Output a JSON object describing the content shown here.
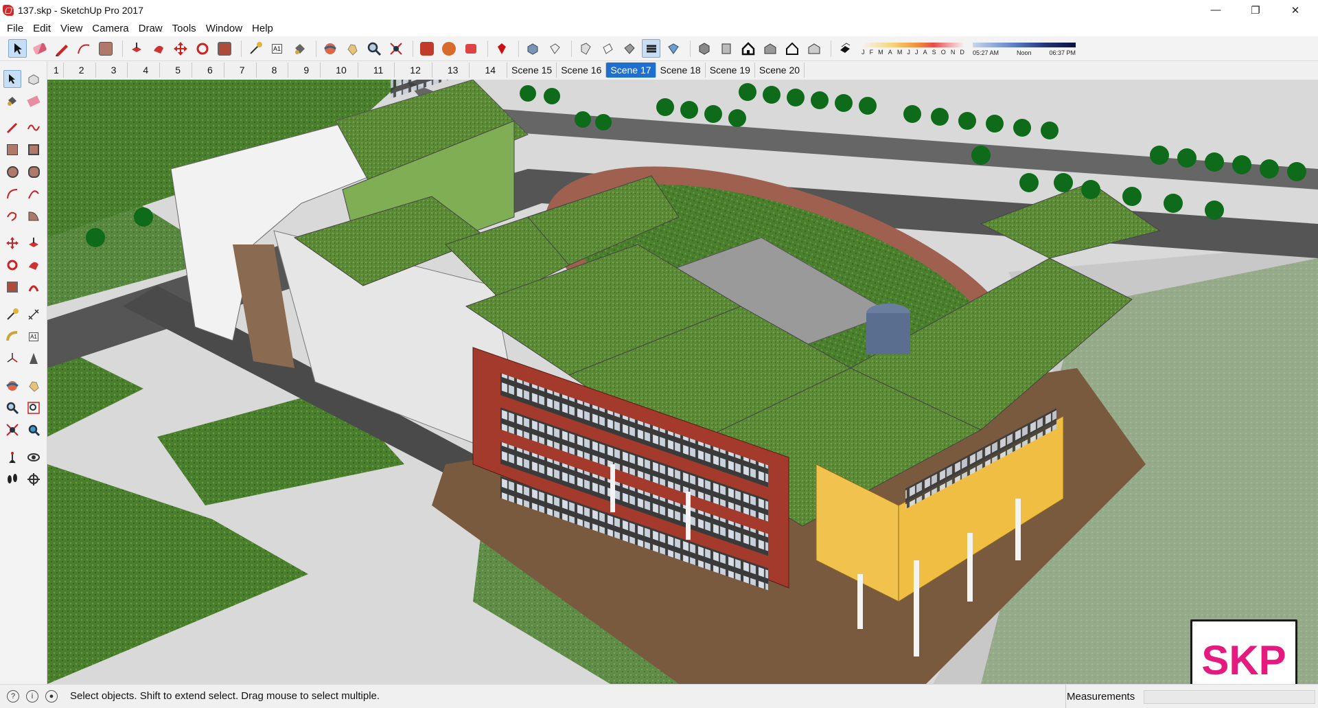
{
  "window": {
    "title": "137.skp - SketchUp Pro 2017",
    "controls": {
      "minimize": "—",
      "maximize": "❐",
      "close": "✕"
    }
  },
  "menu": [
    "File",
    "Edit",
    "View",
    "Camera",
    "Draw",
    "Tools",
    "Window",
    "Help"
  ],
  "toolbar": {
    "icons": [
      "select",
      "eraser",
      "pencil",
      "arc",
      "shape",
      "push-pull",
      "follow-me",
      "move",
      "rotate",
      "scale",
      "tape-measure",
      "text",
      "paint",
      "orbit",
      "pan",
      "zoom",
      "zoom-extents",
      "warehouse",
      "extension-warehouse",
      "components",
      "ruby",
      "iso",
      "top",
      "front",
      "right",
      "back",
      "left",
      "bottom",
      "house",
      "house2",
      "house3",
      "shadow"
    ],
    "months": [
      "J",
      "F",
      "M",
      "A",
      "M",
      "J",
      "J",
      "A",
      "S",
      "O",
      "N",
      "D"
    ],
    "time_labels": [
      "05:27 AM",
      "Noon",
      "06:37 PM"
    ]
  },
  "scenes": [
    "1",
    "2",
    "3",
    "4",
    "5",
    "6",
    "7",
    "8",
    "9",
    "10",
    "11",
    "12",
    "13",
    "14",
    "Scene 15",
    "Scene 16",
    "Scene 17",
    "Scene 18",
    "Scene 19",
    "Scene 20"
  ],
  "active_scene": "Scene 17",
  "status": {
    "message": "Select objects. Shift to extend select. Drag mouse to select multiple.",
    "measurements_label": "Measurements",
    "measurements_value": ""
  },
  "logo": {
    "text": "SKP"
  },
  "colors": {
    "accent": "#1f6fd1",
    "logo": "#e6197e",
    "brick": "#a33a2c",
    "yellow": "#f2c24e",
    "grass": "#3f7a2a"
  }
}
